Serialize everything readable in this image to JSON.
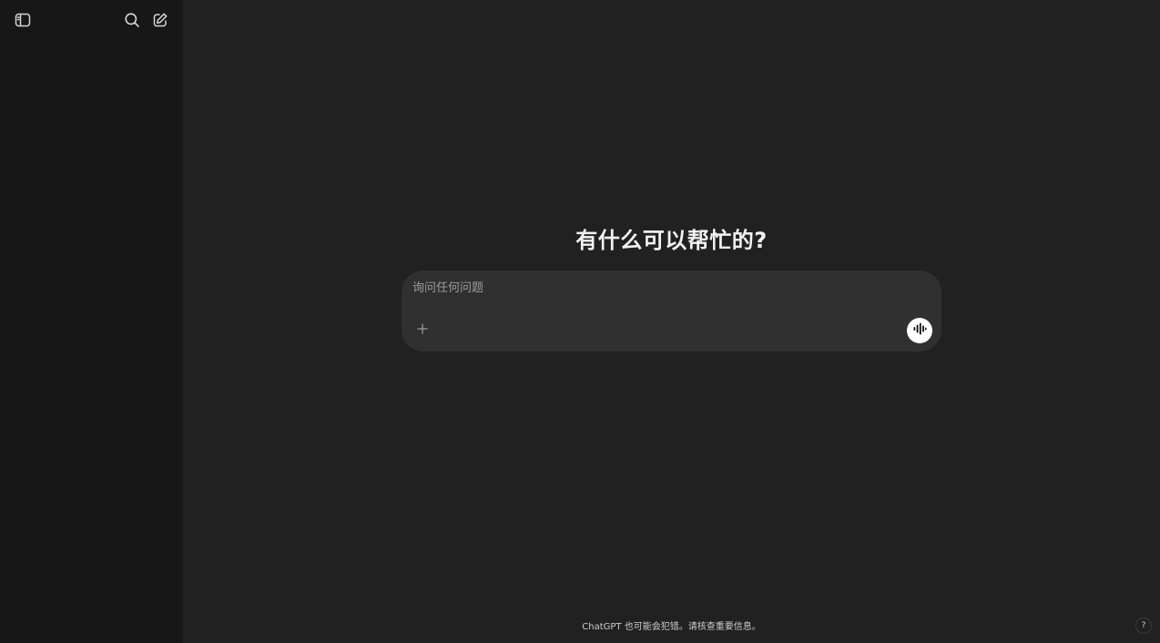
{
  "sidebar": {
    "toggle_icon": "sidebar-toggle-icon",
    "search_icon": "search-icon",
    "new_chat_icon": "edit-icon"
  },
  "main": {
    "heading": "有什么可以帮忙的?",
    "composer": {
      "placeholder": "询问任何问题",
      "value": "",
      "plus_icon": "plus-icon",
      "voice_icon": "voice-waveform-icon"
    },
    "disclaimer": "ChatGPT 也可能会犯错。请核查重要信息。",
    "help_label": "?"
  },
  "colors": {
    "sidebar_bg": "#171717",
    "main_bg": "#212121",
    "composer_bg": "#303030",
    "voice_button_bg": "#ffffff"
  }
}
